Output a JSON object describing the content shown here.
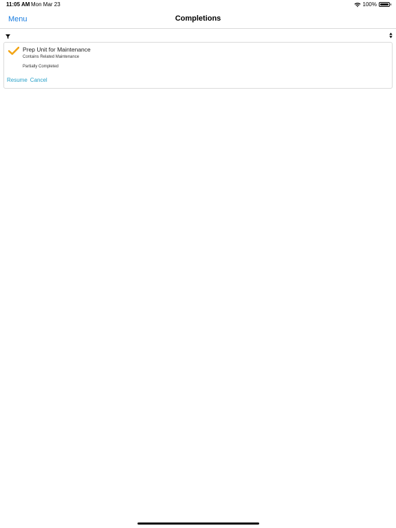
{
  "status_bar": {
    "time": "11:05 AM",
    "date": "Mon Mar 23",
    "battery_text": "100%",
    "wifi_icon": "wifi-icon",
    "battery_icon": "battery-icon",
    "battery_level": 1.0
  },
  "nav": {
    "menu_label": "Menu",
    "title": "Completions"
  },
  "toolbar": {
    "filter_icon": "filter-icon",
    "sort_icon": "sort-icon"
  },
  "completions": [
    {
      "title": "Prep Unit for Maintenance",
      "subtitle": "Contains Related Maintenance",
      "status": "Partially Completed",
      "icon": "checkmark-icon",
      "actions": {
        "resume": "Resume",
        "cancel": "Cancel"
      }
    }
  ],
  "colors": {
    "accent": "#1a7de0",
    "action_link": "#28a0c8",
    "check_orange": "#f2a516",
    "border": "#dadada"
  }
}
